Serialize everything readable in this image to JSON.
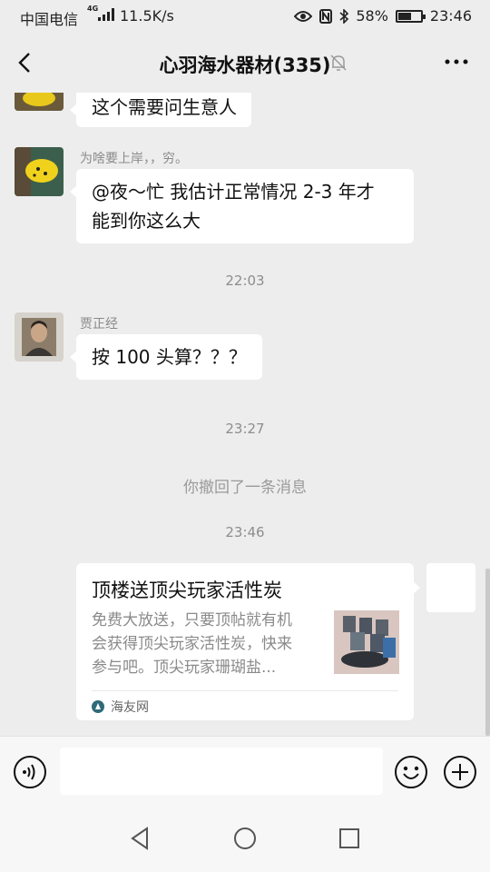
{
  "status_bar": {
    "carrier": "中国电信",
    "network": "4G",
    "speed": "11.5K/s",
    "battery": "58%",
    "battery_level": 0.58,
    "time": "23:46",
    "icons": [
      "signal-icon",
      "eye-icon",
      "nfc-icon",
      "bluetooth-icon",
      "battery-icon"
    ]
  },
  "header": {
    "title": "心羽海水器材(335)",
    "icons": [
      "back-arrow-icon",
      "mute-bell-icon",
      "more-dots-icon"
    ]
  },
  "messages": [
    {
      "type": "text",
      "sender": "",
      "text": "这个需要问生意人"
    },
    {
      "type": "text",
      "sender": "为啥要上岸，，穷。",
      "lines": [
        "@夜～忙  我估计正常情况 2-3 年才",
        "能到你这么大"
      ]
    },
    {
      "type": "time",
      "text": "22:03"
    },
    {
      "type": "text",
      "sender": "贾正经",
      "text": "按 100 头算？？？"
    },
    {
      "type": "time",
      "text": "23:27"
    },
    {
      "type": "system",
      "text": "你撤回了一条消息"
    },
    {
      "type": "time",
      "text": "23:46"
    }
  ],
  "link_card": {
    "title": "顶楼送顶尖玩家活性炭",
    "desc_lines": [
      "免费大放送，只要顶帖就有机",
      "会获得顶尖玩家活性炭，快来",
      "参与吧。顶尖玩家珊瑚盐..."
    ],
    "source": "海友网"
  },
  "input_bar": {
    "placeholder": "",
    "icons": [
      "voice-icon",
      "emoji-icon",
      "plus-icon"
    ]
  },
  "nav_bar": {
    "icons": [
      "nav-back-icon",
      "nav-home-icon",
      "nav-recent-icon"
    ]
  },
  "colors": {
    "background": "#ededed",
    "bubble": "#ffffff",
    "meta_text": "#8a8a8a"
  }
}
